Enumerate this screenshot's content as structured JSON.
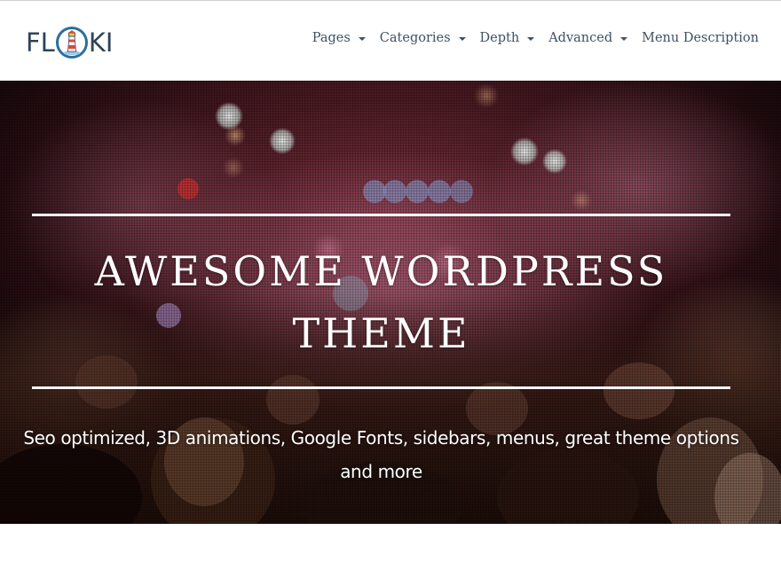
{
  "header": {
    "logo": {
      "prefix": "FL",
      "suffix": "KI"
    },
    "nav": [
      {
        "label": "Pages",
        "has_dropdown": true
      },
      {
        "label": "Categories",
        "has_dropdown": true
      },
      {
        "label": "Depth",
        "has_dropdown": true
      },
      {
        "label": "Advanced",
        "has_dropdown": true
      },
      {
        "label": "Menu Description",
        "has_dropdown": false
      }
    ]
  },
  "hero": {
    "title": "AWESOME WORDPRESS THEME",
    "subtitle": "Seo optimized, 3D animations, Google Fonts, sidebars, menus, great theme options and more",
    "background": "concert-crowd-photo"
  },
  "colors": {
    "text_dark": "#2e4458",
    "nav_text": "#3f5162",
    "lighthouse_red": "#e0463a",
    "logo_ring": "#2a6f9e"
  }
}
